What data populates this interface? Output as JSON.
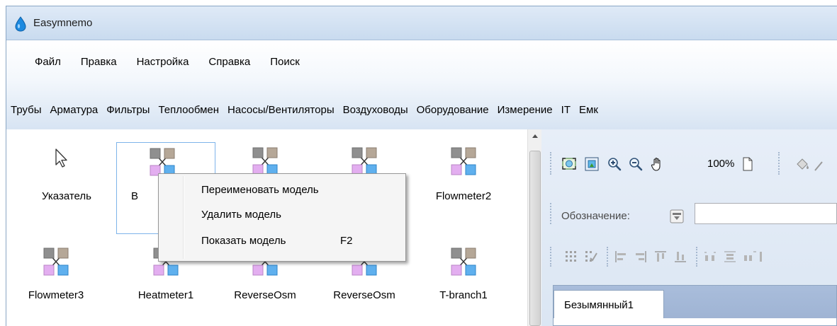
{
  "window": {
    "title": "Easymnemo"
  },
  "menu": [
    "Файл",
    "Правка",
    "Настройка",
    "Справка",
    "Поиск"
  ],
  "categories": [
    "Трубы",
    "Арматура",
    "Фильтры",
    "Теплообмен",
    "Насосы/Вентиляторы",
    "Воздуховоды",
    "Оборудование",
    "Измерение",
    "IT",
    "Емк"
  ],
  "models": {
    "row1": [
      "Указатель",
      "B",
      "",
      "",
      "Flowmeter2"
    ],
    "row2": [
      "Flowmeter3",
      "Heatmeter1",
      "ReverseOsm",
      "ReverseOsm",
      "T-branch1"
    ]
  },
  "toolbar": {
    "zoom": "100%"
  },
  "designation": {
    "label": "Обозначение:"
  },
  "document": {
    "tab": "Безымянный1"
  },
  "context_menu": {
    "rename": "Переименовать модель",
    "delete": "Удалить модель",
    "show": "Показать модель",
    "show_shortcut": "F2"
  },
  "colors": {
    "title_bg": "#c9dbef",
    "selection_border": "#7eb4ea",
    "square_gray": "#8f8f8f",
    "square_tan": "#b5a797",
    "square_pink": "#e3aef0",
    "square_blue": "#5fb0ee"
  }
}
